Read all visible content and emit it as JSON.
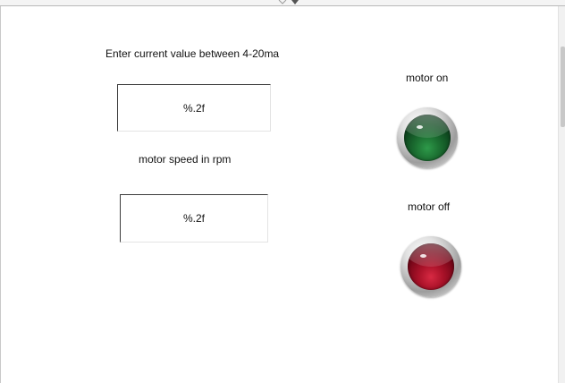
{
  "labels": {
    "current_prompt": "Enter current value between 4-20ma",
    "speed_prompt": "motor speed in rpm",
    "motor_on": "motor on",
    "motor_off": "motor off"
  },
  "fields": {
    "current_value": "%.2f",
    "speed_value": "%.2f"
  },
  "indicators": {
    "motor_on": {
      "color": "#1d7233",
      "icon": "led-green-indicator"
    },
    "motor_off": {
      "color": "#aa1229",
      "icon": "led-red-indicator"
    }
  }
}
